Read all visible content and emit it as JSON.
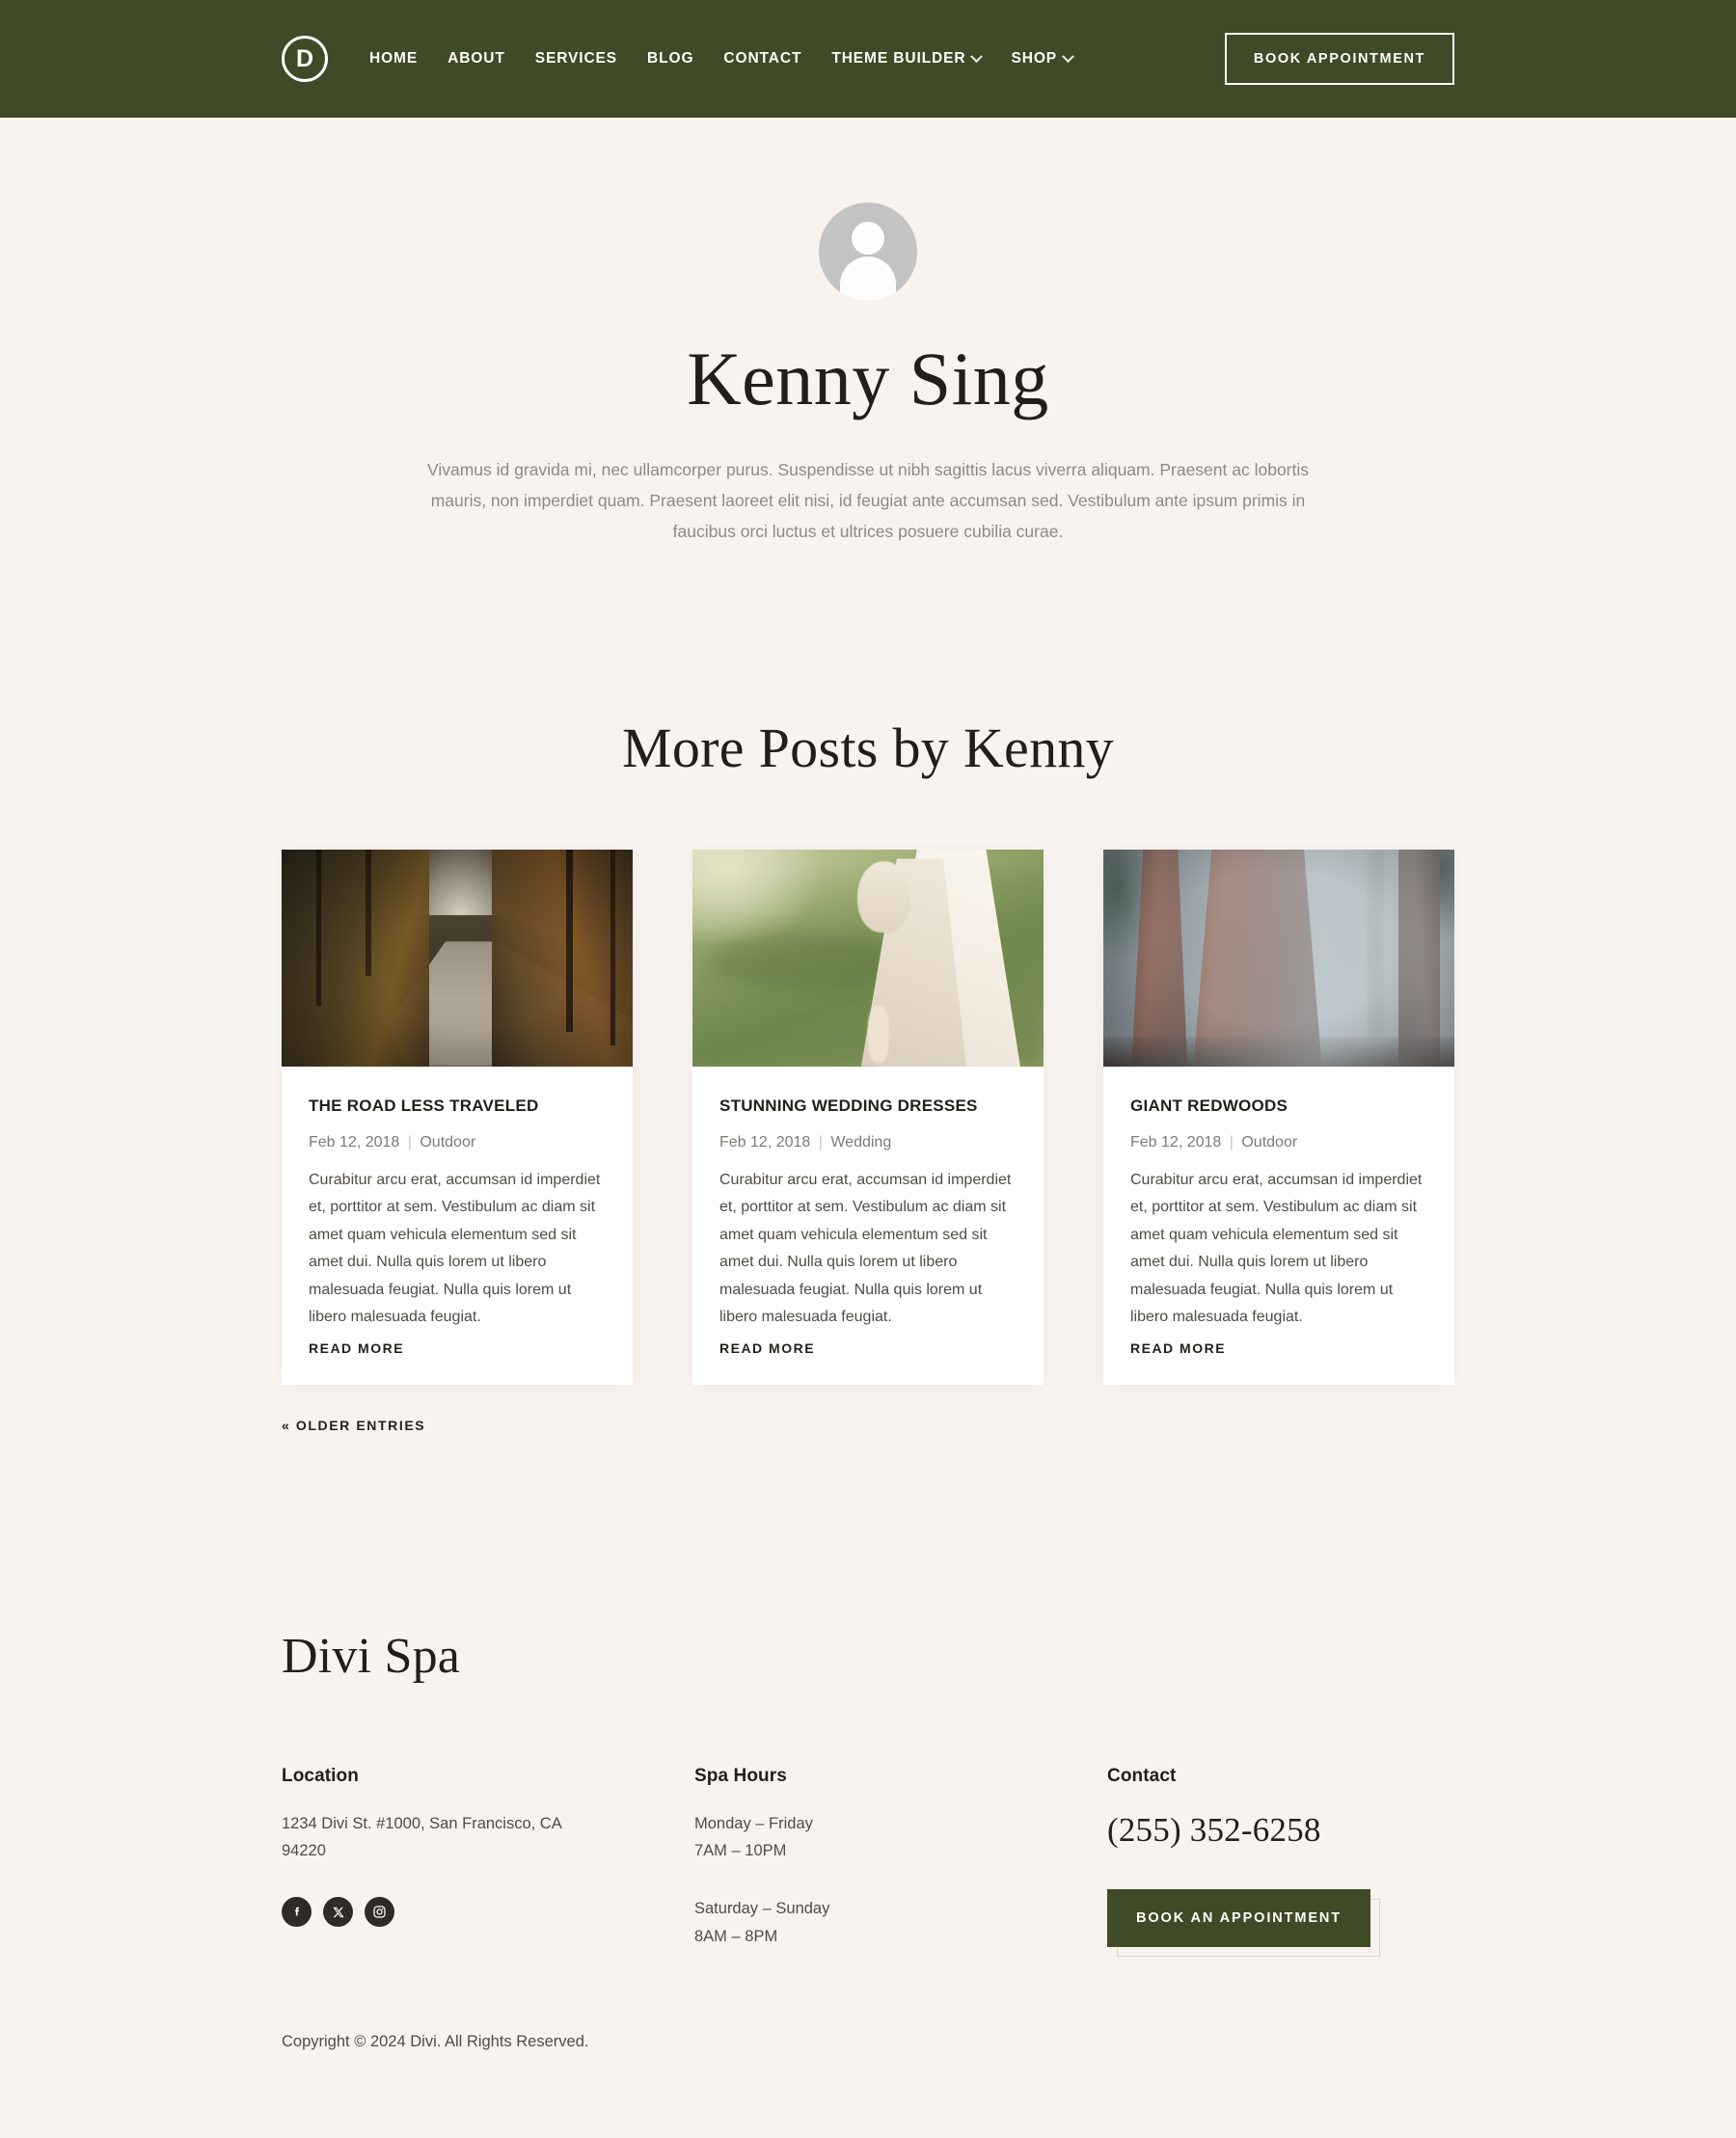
{
  "colors": {
    "nav_green": "#3f4a26",
    "page_background": "#f9f3ef",
    "card_background": "#ffffff",
    "heading_text": "#211f1c",
    "muted_text": "#8d8a85",
    "social_circle": "#2f2c28"
  },
  "header": {
    "logo_letter": "D",
    "nav_items": [
      {
        "label": "HOME",
        "has_dropdown": false
      },
      {
        "label": "ABOUT",
        "has_dropdown": false
      },
      {
        "label": "SERVICES",
        "has_dropdown": false
      },
      {
        "label": "BLOG",
        "has_dropdown": false
      },
      {
        "label": "CONTACT",
        "has_dropdown": false
      },
      {
        "label": "THEME BUILDER",
        "has_dropdown": true
      },
      {
        "label": "SHOP",
        "has_dropdown": true
      }
    ],
    "cta_label": "BOOK APPOINTMENT"
  },
  "author": {
    "avatar_icon": "user-avatar-placeholder",
    "name": "Kenny Sing",
    "bio": "Vivamus id gravida mi, nec ullamcorper purus. Suspendisse ut nibh sagittis lacus viverra aliquam. Praesent ac lobortis mauris, non imperdiet quam. Praesent laoreet elit nisi, id feugiat ante accumsan sed. Vestibulum ante ipsum primis in faucibus orci luctus et ultrices posuere cubilia curae."
  },
  "posts_section": {
    "heading": "More Posts by Kenny",
    "older_entries_label": "« OLDER ENTRIES",
    "posts": [
      {
        "title": "THE ROAD LESS TRAVELED",
        "date": "Feb 12, 2018",
        "category": "Outdoor",
        "separator": "|",
        "excerpt": "Curabitur arcu erat, accumsan id imperdiet et, porttitor at sem. Vestibulum ac diam sit amet quam vehicula elementum sed sit amet dui. Nulla quis lorem ut libero malesuada feugiat. Nulla quis lorem ut libero malesuada feugiat.",
        "read_more_label": "READ MORE",
        "image_alt": "autumn forest dirt road"
      },
      {
        "title": "STUNNING WEDDING DRESSES",
        "date": "Feb 12, 2018",
        "category": "Wedding",
        "separator": "|",
        "excerpt": "Curabitur arcu erat, accumsan id imperdiet et, porttitor at sem. Vestibulum ac diam sit amet quam vehicula elementum sed sit amet dui. Nulla quis lorem ut libero malesuada feugiat. Nulla quis lorem ut libero malesuada feugiat.",
        "read_more_label": "READ MORE",
        "image_alt": "bride in white lace dress on grass"
      },
      {
        "title": "GIANT REDWOODS",
        "date": "Feb 12, 2018",
        "category": "Outdoor",
        "separator": "|",
        "excerpt": "Curabitur arcu erat, accumsan id imperdiet et, porttitor at sem. Vestibulum ac diam sit amet quam vehicula elementum sed sit amet dui. Nulla quis lorem ut libero malesuada feugiat. Nulla quis lorem ut libero malesuada feugiat.",
        "read_more_label": "READ MORE",
        "image_alt": "giant redwood trees in fog"
      }
    ]
  },
  "footer": {
    "brand": "Divi Spa",
    "location": {
      "title": "Location",
      "address": "1234 Divi St. #1000, San Francisco, CA 94220",
      "socials": [
        {
          "name": "facebook-icon",
          "label": "Facebook"
        },
        {
          "name": "x-twitter-icon",
          "label": "X"
        },
        {
          "name": "instagram-icon",
          "label": "Instagram"
        }
      ]
    },
    "hours": {
      "title": "Spa Hours",
      "weekday_days": "Monday – Friday",
      "weekday_time": "7AM – 10PM",
      "weekend_days": "Saturday – Sunday",
      "weekend_time": "8AM – 8PM"
    },
    "contact": {
      "title": "Contact",
      "phone": "(255) 352-6258",
      "cta_label": "BOOK AN APPOINTMENT"
    },
    "copyright": "Copyright © 2024 Divi. All Rights Reserved."
  }
}
